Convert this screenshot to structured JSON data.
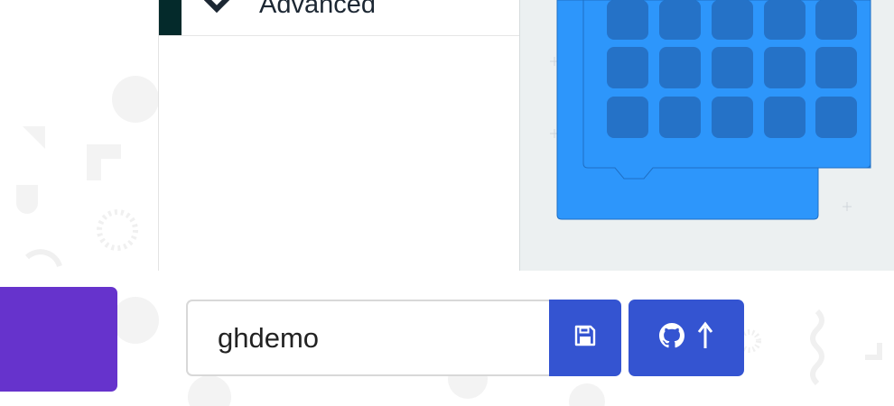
{
  "toolbox": {
    "category": {
      "label": "Advanced",
      "color": "#042a2b",
      "icon": "chevron-down-icon"
    }
  },
  "workspace": {
    "background": "#ecf0f1",
    "block_color": "#2d96fb",
    "led_color": "#2572c7",
    "led_grid_rows_visible": 3,
    "led_grid_cols": 5
  },
  "editor_footer": {
    "project_name": {
      "value": "ghdemo",
      "placeholder": ""
    },
    "save_button": {
      "icon": "save-disk-icon"
    },
    "github_button": {
      "icons": [
        "github-icon",
        "up-arrow-icon"
      ]
    },
    "accent_color": "#3454d1",
    "left_button_color": "#6633cc"
  }
}
